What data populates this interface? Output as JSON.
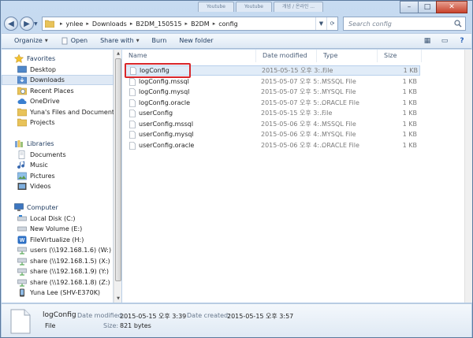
{
  "window": {
    "bg_tabs": [
      "Youtube",
      "Youtube",
      "개념 / 온라인 ..."
    ],
    "buttons": [
      "–",
      "□",
      "✕"
    ]
  },
  "address": {
    "crumbs": [
      "ynlee",
      "Downloads",
      "B2DM_150515",
      "B2DM",
      "config"
    ],
    "search_placeholder": "Search config"
  },
  "toolbar": {
    "organize": "Organize",
    "open": "Open",
    "share_with": "Share with",
    "burn": "Burn",
    "new_folder": "New folder"
  },
  "nav": {
    "favorites": "Favorites",
    "desktop": "Desktop",
    "downloads": "Downloads",
    "recent": "Recent Places",
    "onedrive": "OneDrive",
    "yuna": "Yuna's Files and Documents",
    "projects": "Projects",
    "libraries": "Libraries",
    "documents": "Documents",
    "music": "Music",
    "pictures": "Pictures",
    "videos": "Videos",
    "computer": "Computer",
    "local_disk": "Local Disk (C:)",
    "new_volume": "New Volume (E:)",
    "filevirtualize": "FileVirtualize (H:)",
    "users": "users (\\\\192.168.1.6) (W:)",
    "share_x": "share (\\\\192.168.1.5) (X:)",
    "share_y": "share (\\\\192.168.1.9) (Y:)",
    "share_z": "share (\\\\192.168.1.8) (Z:)",
    "phone": "Yuna Lee (SHV-E370K)"
  },
  "columns": {
    "name": "Name",
    "date": "Date modified",
    "type": "Type",
    "size": "Size"
  },
  "files": [
    {
      "name": "logConfig",
      "date": "2015-05-15 오후 3:...",
      "type": "File",
      "size": "1 KB"
    },
    {
      "name": "logConfig.mssql",
      "date": "2015-05-07 오후 5:...",
      "type": "MSSQL File",
      "size": "1 KB"
    },
    {
      "name": "logConfig.mysql",
      "date": "2015-05-07 오후 5:...",
      "type": "MYSQL File",
      "size": "1 KB"
    },
    {
      "name": "logConfig.oracle",
      "date": "2015-05-07 오후 5:...",
      "type": "ORACLE File",
      "size": "1 KB"
    },
    {
      "name": "userConfig",
      "date": "2015-05-15 오후 3:...",
      "type": "File",
      "size": "1 KB"
    },
    {
      "name": "userConfig.mssql",
      "date": "2015-05-06 오후 4:...",
      "type": "MSSQL File",
      "size": "1 KB"
    },
    {
      "name": "userConfig.mysql",
      "date": "2015-05-06 오후 4:...",
      "type": "MYSQL File",
      "size": "1 KB"
    },
    {
      "name": "userConfig.oracle",
      "date": "2015-05-06 오후 4:...",
      "type": "ORACLE File",
      "size": "1 KB"
    }
  ],
  "details": {
    "name": "logConfig",
    "kind": "File",
    "date_modified_label": "Date modified:",
    "date_modified": "2015-05-15 오후 3:39",
    "date_created_label": "Date created:",
    "date_created": "2015-05-15 오후 3:57",
    "size_label": "Size:",
    "size": "821 bytes"
  },
  "colors": {
    "selection": "#e1ecf8",
    "highlight_box": "#d8262a",
    "frame": "#b6cde6"
  }
}
